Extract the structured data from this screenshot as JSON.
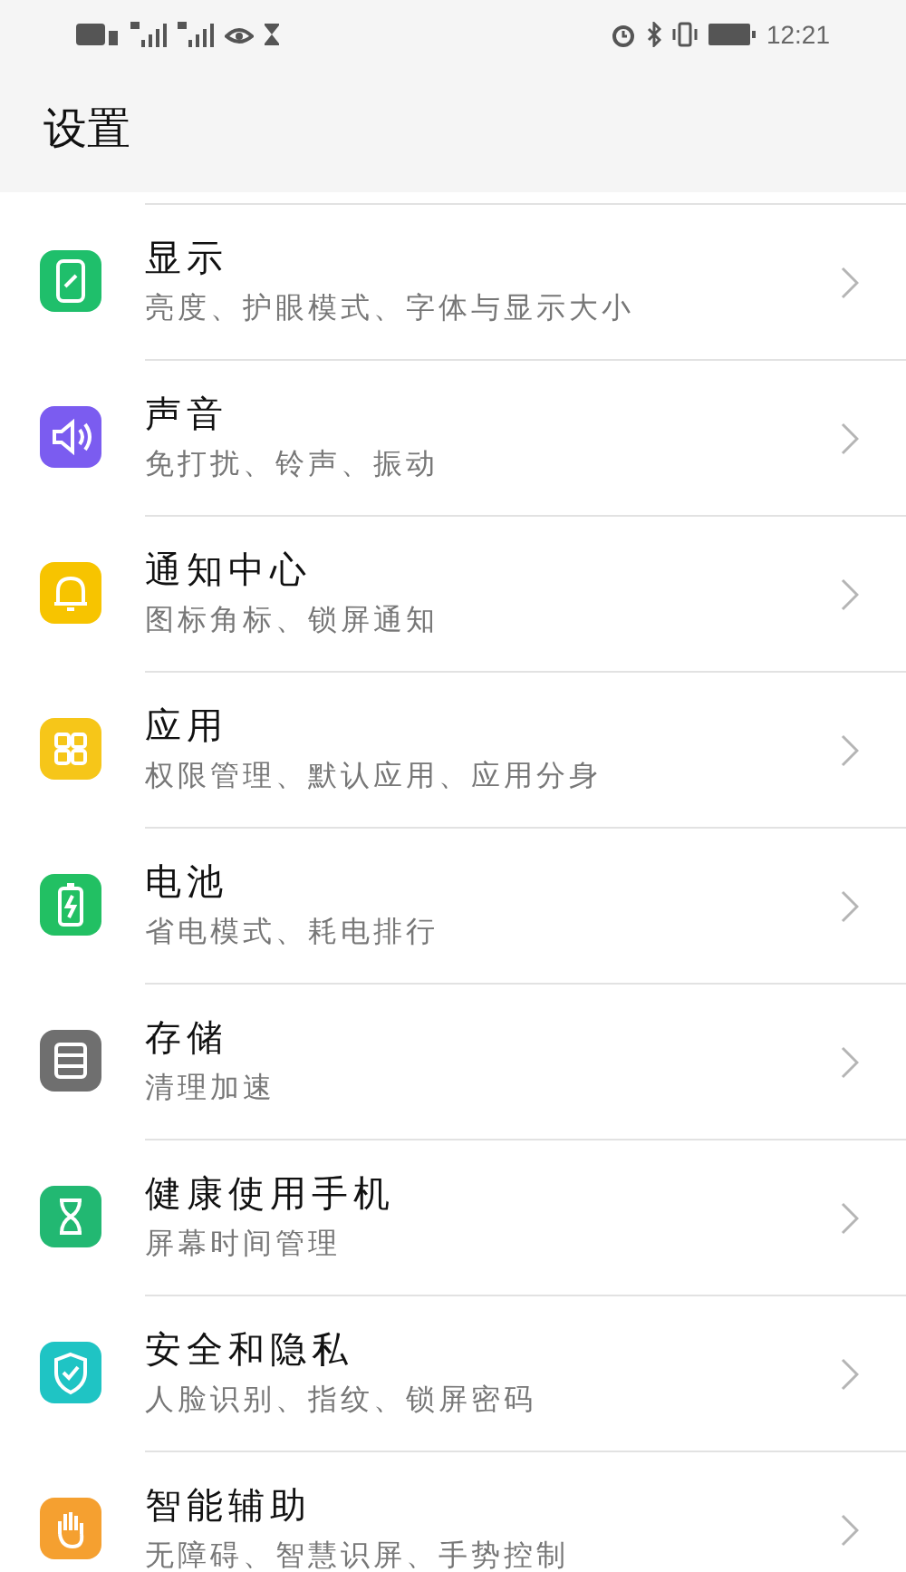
{
  "status_bar": {
    "time": "12:21"
  },
  "title": "设置",
  "items": [
    {
      "kind": "display",
      "title": "显示",
      "subtitle": "亮度、护眼模式、字体与显示大小",
      "color": "#1fbf6b"
    },
    {
      "kind": "sound",
      "title": "声音",
      "subtitle": "免打扰、铃声、振动",
      "color": "#7b5cf0"
    },
    {
      "kind": "bell",
      "title": "通知中心",
      "subtitle": "图标角标、锁屏通知",
      "color": "#f7c400"
    },
    {
      "kind": "apps",
      "title": "应用",
      "subtitle": "权限管理、默认应用、应用分身",
      "color": "#f6c619"
    },
    {
      "kind": "battery",
      "title": "电池",
      "subtitle": "省电模式、耗电排行",
      "color": "#22c063"
    },
    {
      "kind": "storage",
      "title": "存储",
      "subtitle": "清理加速",
      "color": "#6f6f6f"
    },
    {
      "kind": "hourglass",
      "title": "健康使用手机",
      "subtitle": "屏幕时间管理",
      "color": "#22b872"
    },
    {
      "kind": "shield",
      "title": "安全和隐私",
      "subtitle": "人脸识别、指纹、锁屏密码",
      "color": "#1fc4c4"
    },
    {
      "kind": "hand",
      "title": "智能辅助",
      "subtitle": "无障碍、智慧识屏、手势控制",
      "color": "#f5a030"
    }
  ]
}
